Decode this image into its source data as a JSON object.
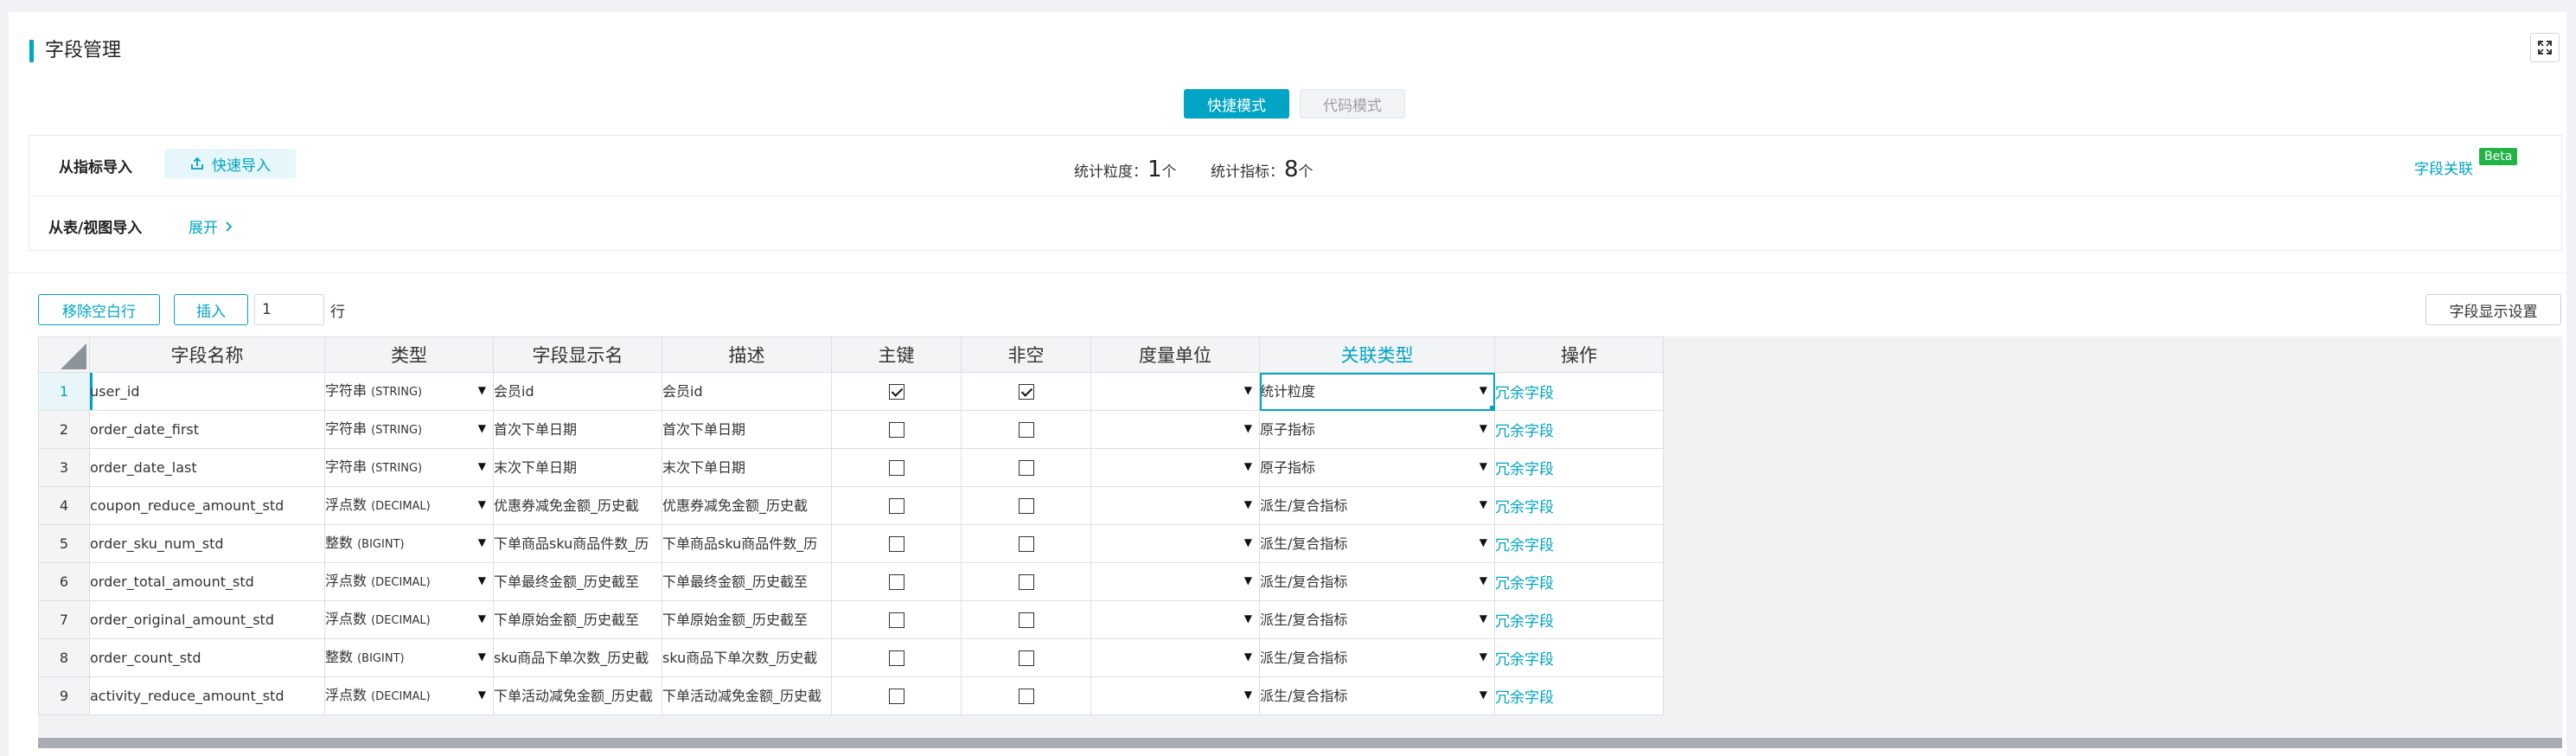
{
  "page": {
    "title": "字段管理"
  },
  "modes": {
    "quick": "快捷模式",
    "code": "代码模式",
    "active": "quick"
  },
  "import": {
    "from_metric_label": "从指标导入",
    "quick_import_label": "快速导入",
    "from_table_label": "从表/视图导入",
    "expand_label": "展开",
    "stats": {
      "granularity_label": "统计粒度：",
      "granularity_count": "1",
      "metric_label": "统计指标：",
      "metric_count": "8",
      "unit": "个"
    },
    "field_relation_label": "字段关联",
    "beta_badge": "Beta"
  },
  "toolbar": {
    "remove_empty_rows_label": "移除空白行",
    "insert_label": "插入",
    "insert_count": "1",
    "row_unit": "行",
    "display_settings_label": "字段显示设置"
  },
  "table": {
    "columns": [
      "字段名称",
      "类型",
      "字段显示名",
      "描述",
      "主键",
      "非空",
      "度量单位",
      "关联类型",
      "操作"
    ],
    "active_column": "关联类型",
    "rows": [
      {
        "num": "1",
        "name": "user_id",
        "type": "字符串",
        "type_sub": "(STRING)",
        "display_name": "会员id",
        "description": "会员id",
        "pk": true,
        "not_null": true,
        "unit": "",
        "relation": "统计粒度",
        "op": "冗余字段"
      },
      {
        "num": "2",
        "name": "order_date_first",
        "type": "字符串",
        "type_sub": "(STRING)",
        "display_name": "首次下单日期",
        "description": "首次下单日期",
        "pk": false,
        "not_null": false,
        "unit": "",
        "relation": "原子指标",
        "op": "冗余字段"
      },
      {
        "num": "3",
        "name": "order_date_last",
        "type": "字符串",
        "type_sub": "(STRING)",
        "display_name": "末次下单日期",
        "description": "末次下单日期",
        "pk": false,
        "not_null": false,
        "unit": "",
        "relation": "原子指标",
        "op": "冗余字段"
      },
      {
        "num": "4",
        "name": "coupon_reduce_amount_std",
        "type": "浮点数",
        "type_sub": "(DECIMAL)",
        "display_name": "优惠券减免金额_历史截",
        "description": "优惠券减免金额_历史截",
        "pk": false,
        "not_null": false,
        "unit": "",
        "relation": "派生/复合指标",
        "op": "冗余字段"
      },
      {
        "num": "5",
        "name": "order_sku_num_std",
        "type": "整数",
        "type_sub": "(BIGINT)",
        "display_name": "下单商品sku商品件数_历",
        "description": "下单商品sku商品件数_历",
        "pk": false,
        "not_null": false,
        "unit": "",
        "relation": "派生/复合指标",
        "op": "冗余字段"
      },
      {
        "num": "6",
        "name": "order_total_amount_std",
        "type": "浮点数",
        "type_sub": "(DECIMAL)",
        "display_name": "下单最终金额_历史截至",
        "description": "下单最终金额_历史截至",
        "pk": false,
        "not_null": false,
        "unit": "",
        "relation": "派生/复合指标",
        "op": "冗余字段"
      },
      {
        "num": "7",
        "name": "order_original_amount_std",
        "type": "浮点数",
        "type_sub": "(DECIMAL)",
        "display_name": "下单原始金额_历史截至",
        "description": "下单原始金额_历史截至",
        "pk": false,
        "not_null": false,
        "unit": "",
        "relation": "派生/复合指标",
        "op": "冗余字段"
      },
      {
        "num": "8",
        "name": "order_count_std",
        "type": "整数",
        "type_sub": "(BIGINT)",
        "display_name": "sku商品下单次数_历史截",
        "description": "sku商品下单次数_历史截",
        "pk": false,
        "not_null": false,
        "unit": "",
        "relation": "派生/复合指标",
        "op": "冗余字段"
      },
      {
        "num": "9",
        "name": "activity_reduce_amount_std",
        "type": "浮点数",
        "type_sub": "(DECIMAL)",
        "display_name": "下单活动减免金额_历史截",
        "description": "下单活动减免金额_历史截",
        "pk": false,
        "not_null": false,
        "unit": "",
        "relation": "派生/复合指标",
        "op": "冗余字段"
      }
    ]
  },
  "icons": {
    "fullscreen": "fullscreen-icon",
    "quick_import": "import-icon",
    "expand": "chevron-right-icon",
    "dropdown": "caret-down-icon"
  },
  "colors": {
    "accent": "#00a4c5",
    "beta": "#22b347"
  }
}
